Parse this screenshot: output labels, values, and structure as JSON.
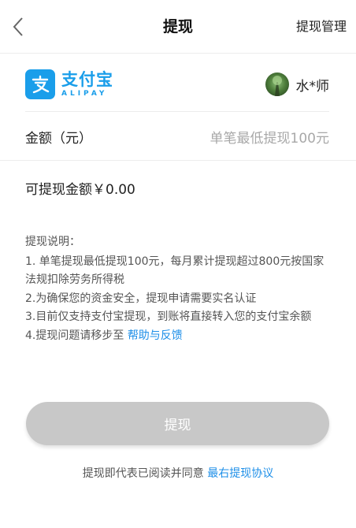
{
  "header": {
    "title": "提现",
    "action_label": "提现管理"
  },
  "account": {
    "brand_cn": "支付宝",
    "brand_en": "ALIPAY",
    "user_name": "水*师"
  },
  "amount": {
    "label": "金额（元）",
    "placeholder": "单笔最低提现100元"
  },
  "available": {
    "text": "可提现金额￥0.00"
  },
  "notes": {
    "title": "提现说明：",
    "line1": "1. 单笔提现最低提现100元，每月累计提现超过800元按国家法规扣除劳务所得税",
    "line2": "2.为确保您的资金安全，提现申请需要实名认证",
    "line3": "3.目前仅支持支付宝提现，到账将直接转入您的支付宝余额",
    "line4_prefix": "4.提现问题请移步至 ",
    "line4_link": "帮助与反馈"
  },
  "submit": {
    "label": "提现"
  },
  "agreement": {
    "prefix": "提现即代表已阅读并同意 ",
    "link": "最右提现协议"
  },
  "colors": {
    "alipay_blue": "#1a9eea",
    "link_blue": "#1e8fe8",
    "button_disabled": "#c8c8c8"
  }
}
